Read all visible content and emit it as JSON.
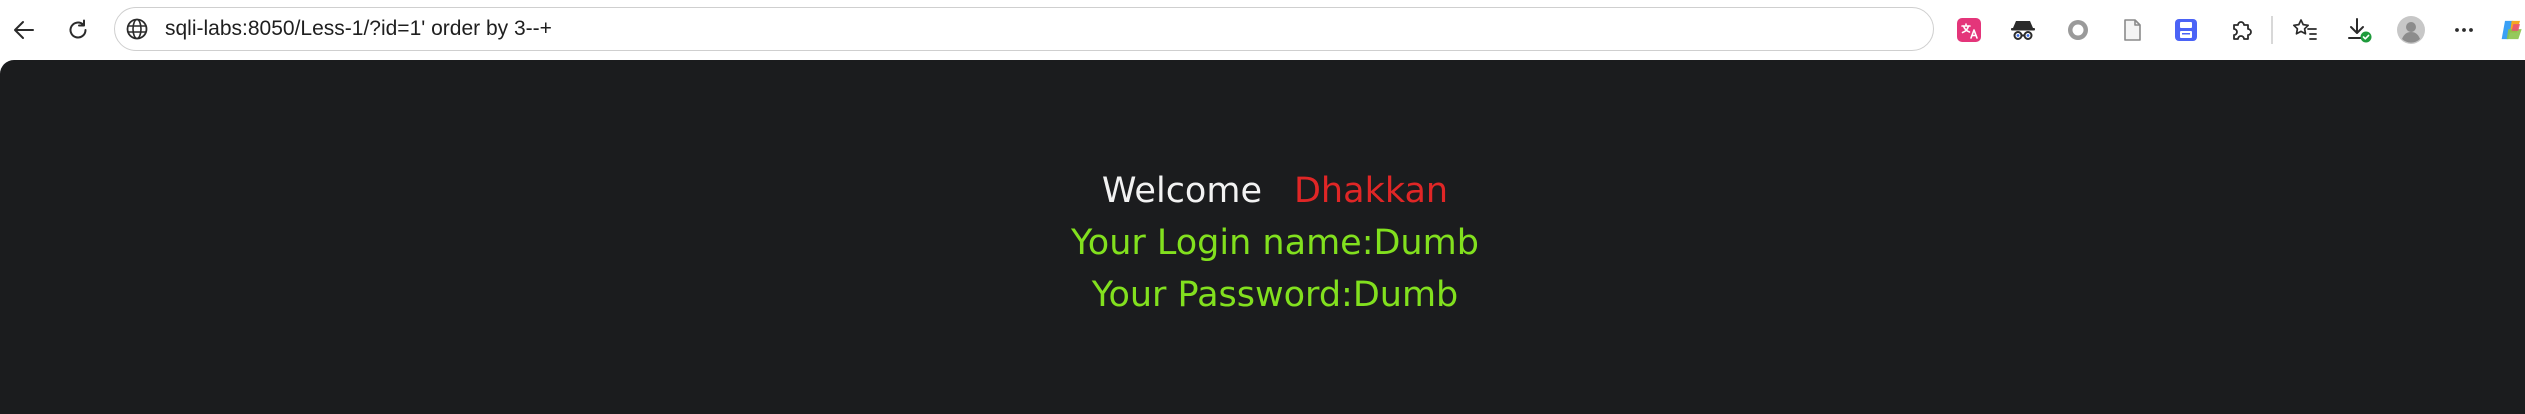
{
  "browser": {
    "url": "sqli-labs:8050/Less-1/?id=1' order by 3--+",
    "icons": {
      "back": "back-arrow-icon",
      "reload": "reload-icon",
      "site": "globe-icon",
      "translate": "translate-extension-icon",
      "spy": "spy-extension-icon",
      "circle": "circle-extension-icon",
      "doc": "document-extension-icon",
      "save": "save-extension-icon",
      "puzzle": "extensions-puzzle-icon",
      "favorites": "favorites-star-icon",
      "download": "downloads-icon",
      "profile": "profile-avatar-icon",
      "more": "more-menu-icon",
      "copilot": "copilot-icon"
    },
    "colors": {
      "page_background": "#1b1c1e",
      "welcome_text": "#f2f2f2",
      "username_text": "#e02626",
      "login_text": "#82e01e",
      "save_icon": "#4b63f6",
      "translate_icon": "#e4357a"
    }
  },
  "page": {
    "welcome_label": "Welcome",
    "username": "Dhakkan",
    "login_line": "Your Login name:Dumb",
    "password_line": "Your Password:Dumb"
  }
}
